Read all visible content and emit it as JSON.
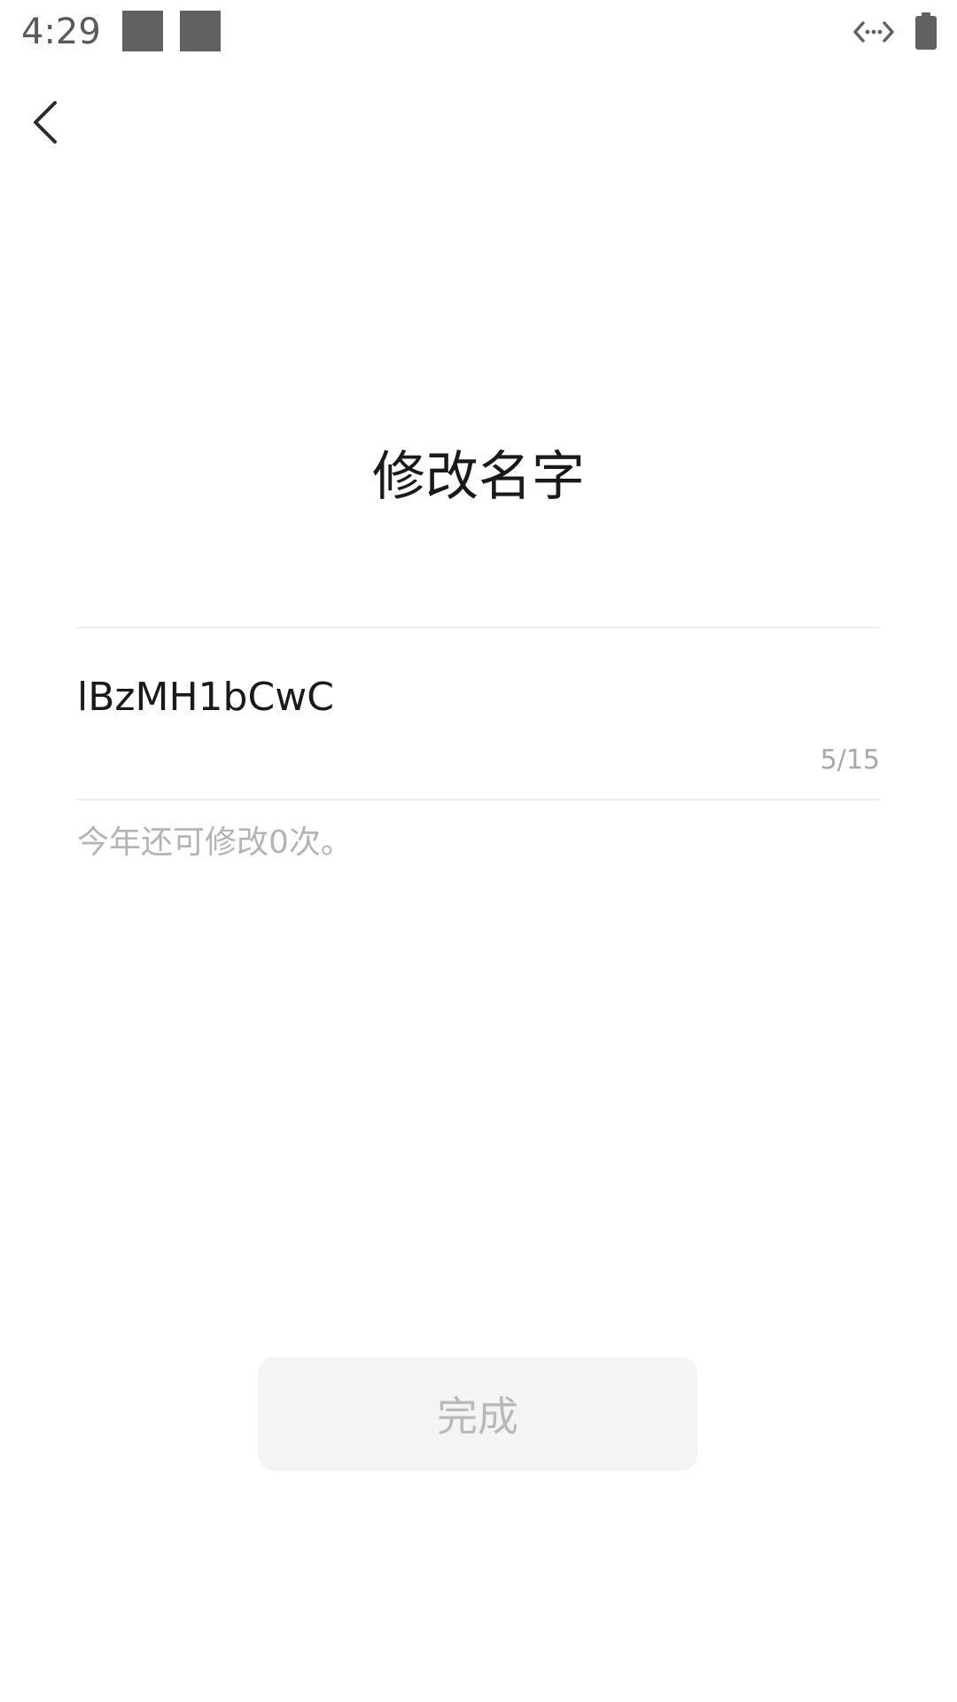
{
  "status_bar": {
    "time": "4:29",
    "icons": [
      "notification-placeholder-icon",
      "notification-placeholder-icon",
      "data-transfer-icon",
      "battery-icon"
    ]
  },
  "header": {
    "back_icon": "chevron-left-icon"
  },
  "main": {
    "title": "修改名字",
    "name_value": "lBzMH1bCwC",
    "char_count": "5/15",
    "hint": "今年还可修改0次。"
  },
  "footer": {
    "done_label": "完成"
  },
  "colors": {
    "title_text": "#1a1a1a",
    "muted_text": "#b4b4b4",
    "divider": "#ececec",
    "button_bg_disabled": "#f4f4f4",
    "button_text_disabled": "#b9b9b9",
    "status_icon": "#616161"
  }
}
